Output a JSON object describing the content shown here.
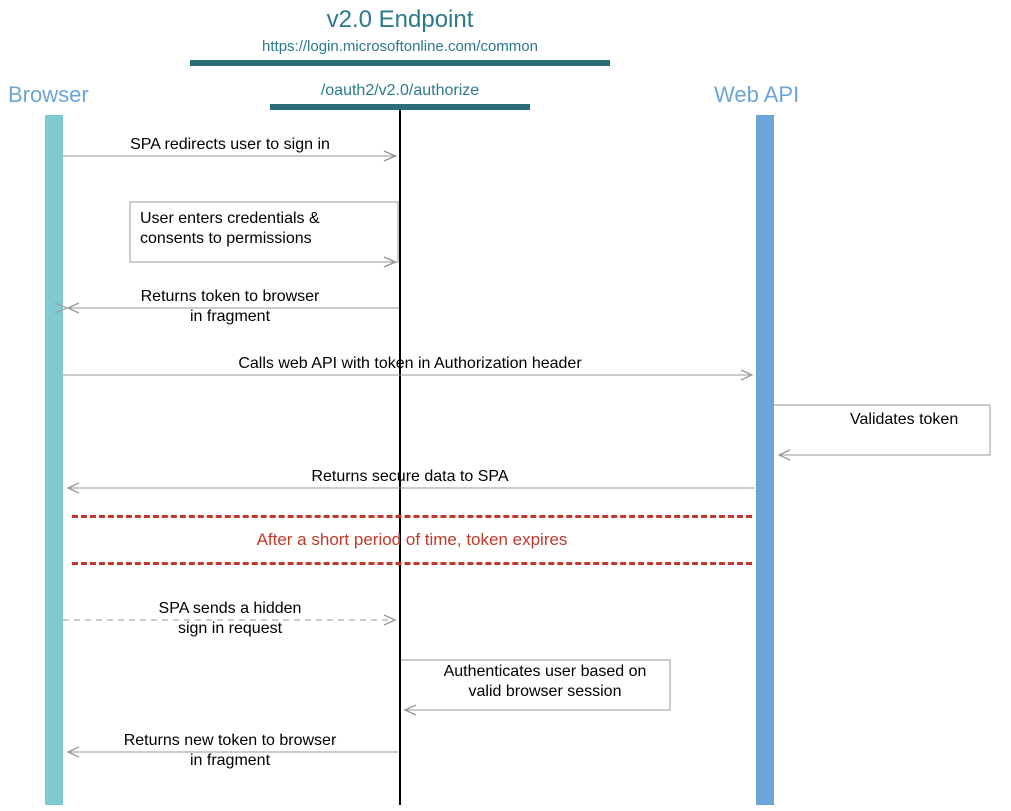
{
  "header": {
    "title": "v2.0 Endpoint",
    "url": "https://login.microsoftonline.com/common",
    "path": "/oauth2/v2.0/authorize"
  },
  "lanes": {
    "browser": "Browser",
    "webapi": "Web API"
  },
  "messages": {
    "m1": "SPA redirects user to sign in",
    "m2a": "User enters credentials &",
    "m2b": "consents to permissions",
    "m3a": "Returns token to browser",
    "m3b": "in fragment",
    "m4": "Calls web API with token in Authorization header",
    "m5": "Validates token",
    "m6": "Returns secure data to SPA",
    "m7": "After a short period of time, token expires",
    "m8a": "SPA sends a hidden",
    "m8b": "sign in request",
    "m9a": "Authenticates user based on",
    "m9b": "valid browser session",
    "m10a": "Returns new token to browser",
    "m10b": "in fragment"
  }
}
